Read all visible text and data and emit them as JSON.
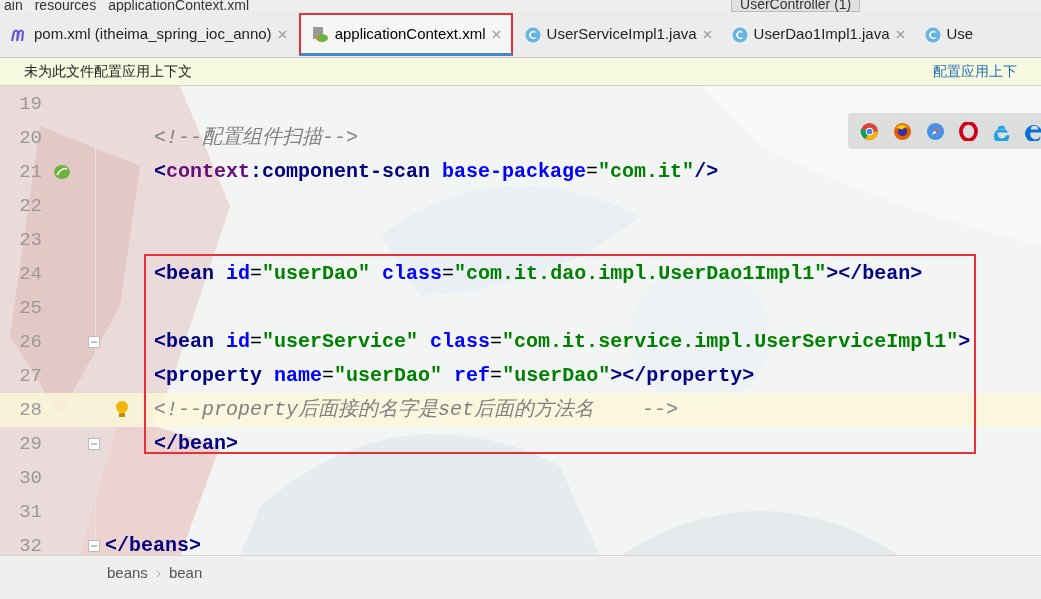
{
  "top_strip": {
    "breadcrumbs": [
      "ain",
      "resources",
      "applicationContext.xml"
    ],
    "run_config": "UserController (1)"
  },
  "tabs": [
    {
      "label": "pom.xml (itheima_spring_ioc_anno)",
      "kind": "maven",
      "selected": false
    },
    {
      "label": "applicationContext.xml",
      "kind": "xml",
      "selected": true
    },
    {
      "label": "UserServiceImpl1.java",
      "kind": "class",
      "selected": false
    },
    {
      "label": "UserDao1Impl1.java",
      "kind": "class",
      "selected": false
    },
    {
      "label": "Use",
      "kind": "class",
      "selected": false
    }
  ],
  "notification": {
    "message": "未为此文件配置应用上下文",
    "action": "配置应用上下"
  },
  "editor": {
    "lines": [
      {
        "number": "19",
        "current": false,
        "bean_marker": false,
        "bulb": false,
        "foldable": false
      },
      {
        "number": "20",
        "indent": true,
        "current": false,
        "bean_marker": false,
        "bulb": false,
        "foldable": false,
        "tokens": [
          {
            "kind": "comment",
            "text": "<!--配置组件扫描-->"
          }
        ]
      },
      {
        "number": "21",
        "indent": true,
        "current": false,
        "bean_marker": true,
        "bulb": false,
        "foldable": false,
        "tokens": [
          {
            "kind": "bracket",
            "text": "<"
          },
          {
            "kind": "ns",
            "text": "context"
          },
          {
            "kind": "tag",
            "text": ":component-scan "
          },
          {
            "kind": "attr",
            "text": "base-package"
          },
          {
            "kind": "plain",
            "text": "="
          },
          {
            "kind": "value",
            "text": "\"com.it\""
          },
          {
            "kind": "bracket",
            "text": "/>"
          }
        ]
      },
      {
        "number": "22",
        "current": false,
        "bean_marker": false,
        "bulb": false,
        "foldable": false
      },
      {
        "number": "23",
        "current": false,
        "bean_marker": false,
        "bulb": false,
        "foldable": false
      },
      {
        "number": "24",
        "indent": true,
        "current": false,
        "bean_marker": false,
        "bulb": false,
        "foldable": false,
        "tokens": [
          {
            "kind": "tag",
            "text": "<bean "
          },
          {
            "kind": "attr",
            "text": "id"
          },
          {
            "kind": "plain",
            "text": "="
          },
          {
            "kind": "value",
            "text": "\"userDao\" "
          },
          {
            "kind": "attr",
            "text": "class"
          },
          {
            "kind": "plain",
            "text": "="
          },
          {
            "kind": "value",
            "text": "\"com.it.dao.impl.UserDao1Impl1\""
          },
          {
            "kind": "tag",
            "text": "></bean>"
          }
        ]
      },
      {
        "number": "25",
        "current": false,
        "bean_marker": false,
        "bulb": false,
        "foldable": false
      },
      {
        "number": "26",
        "indent": true,
        "current": false,
        "bean_marker": false,
        "bulb": false,
        "foldable": true,
        "tokens": [
          {
            "kind": "tag",
            "text": "<bean "
          },
          {
            "kind": "attr",
            "text": "id"
          },
          {
            "kind": "plain",
            "text": "="
          },
          {
            "kind": "value",
            "text": "\"userService\" "
          },
          {
            "kind": "attr",
            "text": "class"
          },
          {
            "kind": "plain",
            "text": "="
          },
          {
            "kind": "value",
            "text": "\"com.it.service.impl.UserServiceImpl1\""
          },
          {
            "kind": "tag",
            "text": ">"
          }
        ]
      },
      {
        "number": "27",
        "indent": true,
        "current": false,
        "bean_marker": false,
        "bulb": false,
        "foldable": false,
        "tokens": [
          {
            "kind": "tag",
            "text": "<property "
          },
          {
            "kind": "attr",
            "text": "name"
          },
          {
            "kind": "plain",
            "text": "="
          },
          {
            "kind": "value",
            "text": "\"userDao\" "
          },
          {
            "kind": "attr",
            "text": "ref"
          },
          {
            "kind": "plain",
            "text": "="
          },
          {
            "kind": "value",
            "text": "\"userDao\""
          },
          {
            "kind": "tag",
            "text": "></property>"
          }
        ]
      },
      {
        "number": "28",
        "indent": true,
        "current": true,
        "bean_marker": false,
        "bulb": true,
        "foldable": false,
        "tokens": [
          {
            "kind": "comment",
            "text": "<!--property后面接的名字是set后面的方法名    -->"
          }
        ]
      },
      {
        "number": "29",
        "indent": true,
        "current": false,
        "bean_marker": false,
        "bulb": false,
        "foldable": true,
        "tokens": [
          {
            "kind": "tag",
            "text": "</bean>"
          }
        ]
      },
      {
        "number": "30",
        "current": false,
        "bean_marker": false,
        "bulb": false,
        "foldable": false
      },
      {
        "number": "31",
        "current": false,
        "bean_marker": false,
        "bulb": false,
        "foldable": false
      },
      {
        "number": "32",
        "indent": false,
        "current": false,
        "bean_marker": false,
        "bulb": false,
        "foldable": true,
        "tokens": [
          {
            "kind": "tag",
            "text": "</beans>"
          }
        ]
      }
    ]
  },
  "breadcrumb": [
    "beans",
    "bean"
  ]
}
